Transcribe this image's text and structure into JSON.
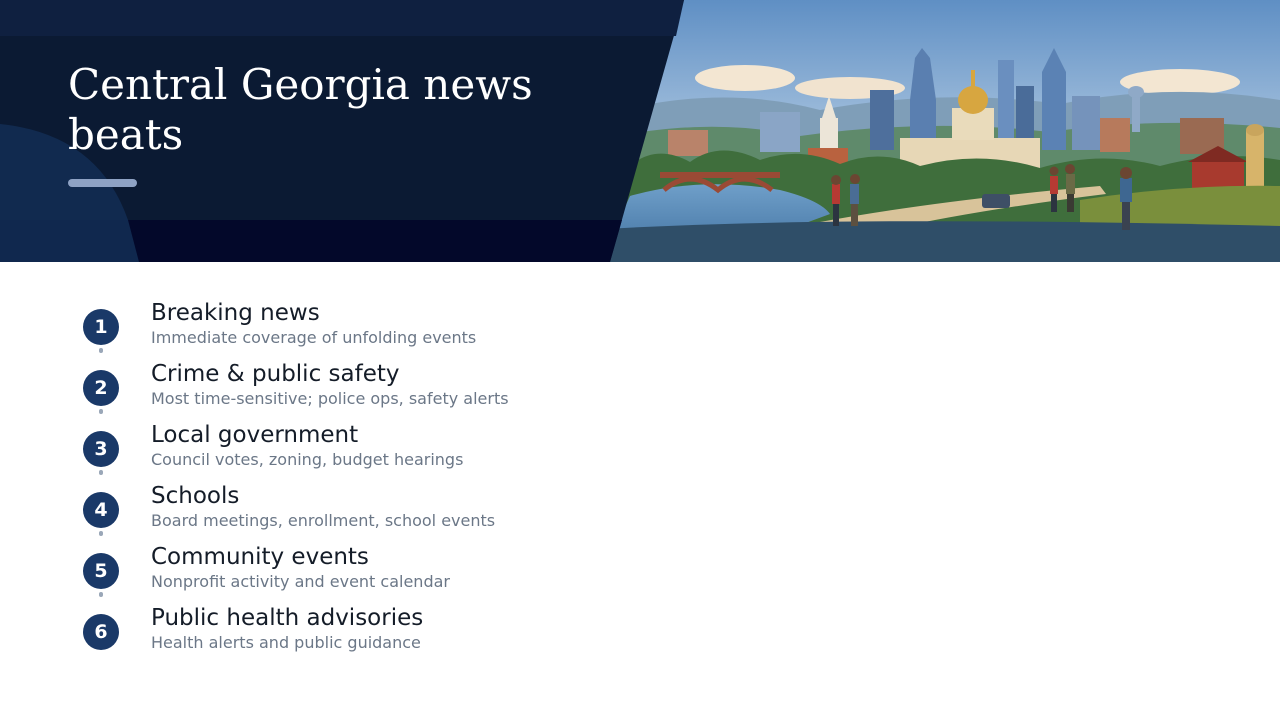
{
  "banner": {
    "title": "Central Georgia news beats",
    "image": "city-skyline-illustration"
  },
  "beats": [
    {
      "number": "1",
      "title": "Breaking news",
      "subtitle": "Immediate coverage of unfolding events"
    },
    {
      "number": "2",
      "title": "Crime & public safety",
      "subtitle": "Most time-sensitive; police ops, safety alerts"
    },
    {
      "number": "3",
      "title": "Local government",
      "subtitle": "Council votes, zoning, budget hearings"
    },
    {
      "number": "4",
      "title": "Schools",
      "subtitle": "Board meetings, enrollment, school events"
    },
    {
      "number": "5",
      "title": "Community events",
      "subtitle": "Nonprofit activity and event calendar"
    },
    {
      "number": "6",
      "title": "Public health advisories",
      "subtitle": "Health alerts and public guidance"
    }
  ],
  "colors": {
    "navy": "#0b1a33",
    "badge": "#1a3968",
    "accent": "#8ea2c4",
    "title_text": "#141c28",
    "subtitle_text": "#6b7787"
  }
}
